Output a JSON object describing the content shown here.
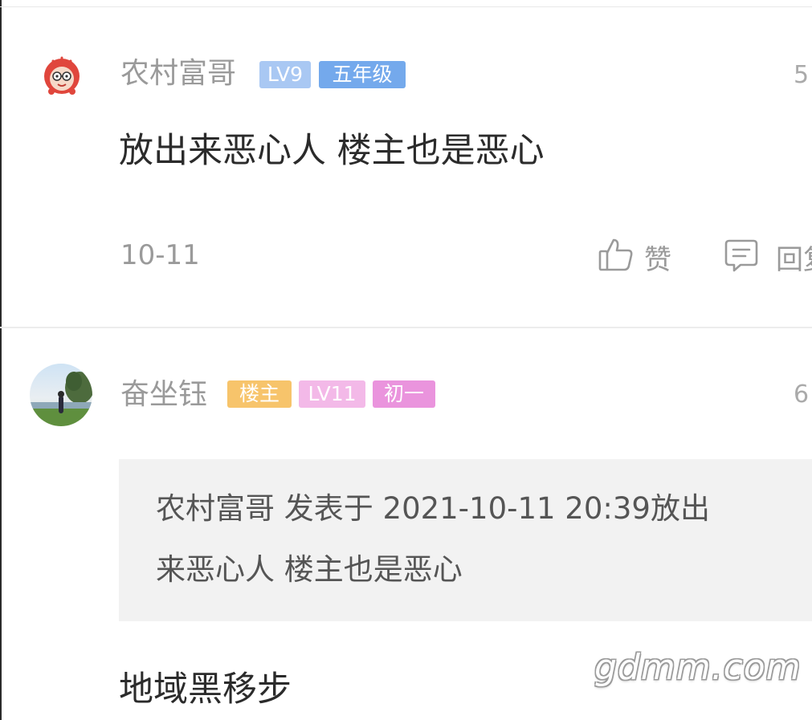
{
  "comments": [
    {
      "username": "农村富哥",
      "badges": [
        {
          "text": "LV9",
          "color": "#a9c8f3"
        },
        {
          "text": "五年级",
          "color": "#74a9ec"
        }
      ],
      "time_partial": "5",
      "content": "放出来恶心人  楼主也是恶心",
      "date": "10-11",
      "actions": {
        "like_label": "赞",
        "reply_label": "回复"
      }
    },
    {
      "username": "奋坐钰",
      "badges": [
        {
          "text": "楼主",
          "color": "#f7c46b"
        },
        {
          "text": "LV11",
          "color": "#f3b9e8"
        },
        {
          "text": "初一",
          "color": "#ea94dd"
        }
      ],
      "time_partial": "6",
      "quote": {
        "line1": "农村富哥 发表于 2021-10-11 20:39放出",
        "line2": "来恶心人  楼主也是恶心"
      },
      "content": "地域黑移步"
    }
  ],
  "watermark": "gdmm.com"
}
